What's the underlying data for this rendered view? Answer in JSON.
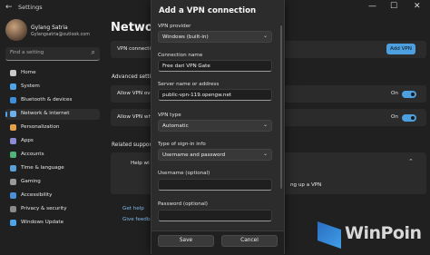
{
  "window": {
    "title": "Settings",
    "back_glyph": "←",
    "min_glyph": "—",
    "max_glyph": "☐",
    "close_glyph": "✕"
  },
  "user": {
    "name": "Gylang Satria",
    "email": "Gylangsatria@outlook.com"
  },
  "search": {
    "placeholder": "Find a setting",
    "icon": "⌕"
  },
  "sidebar": {
    "items": [
      {
        "label": "Home",
        "icon_color": "#c9c9c9"
      },
      {
        "label": "System",
        "icon_color": "#4fa4e8"
      },
      {
        "label": "Bluetooth & devices",
        "icon_color": "#3f8fd8"
      },
      {
        "label": "Network & internet",
        "icon_color": "#6db0ea"
      },
      {
        "label": "Personalization",
        "icon_color": "#e2a04a"
      },
      {
        "label": "Apps",
        "icon_color": "#8c8cd6"
      },
      {
        "label": "Accounts",
        "icon_color": "#4fb37a"
      },
      {
        "label": "Time & language",
        "icon_color": "#5aa0d8"
      },
      {
        "label": "Gaming",
        "icon_color": "#9a9a9a"
      },
      {
        "label": "Accessibility",
        "icon_color": "#4a90d9"
      },
      {
        "label": "Privacy & security",
        "icon_color": "#8a8a8a"
      },
      {
        "label": "Windows Update",
        "icon_color": "#4fa4e8"
      }
    ]
  },
  "main": {
    "title": "Network",
    "vpn_connections": "VPN connection",
    "add_vpn": "Add VPN",
    "advanced": "Advanced setting",
    "allow_over": "Allow VPN ove",
    "allow_while": "Allow VPN whi",
    "on1": "On",
    "on2": "On",
    "related": "Related support",
    "help": "Help wi",
    "setup": "ng up a VPN",
    "get_help": "Get help",
    "give_feedback": "Give feedback"
  },
  "modal": {
    "title": "Add a VPN connection",
    "vpn_provider_label": "VPN provider",
    "vpn_provider_value": "Windows (built-in)",
    "connection_name_label": "Connection name",
    "connection_name_value": "Free dari VPN Gate",
    "server_label": "Server name or address",
    "server_value": "public-vpn-119.opengw.net",
    "vpn_type_label": "VPN type",
    "vpn_type_value": "Automatic",
    "signin_label": "Type of sign-in info",
    "signin_value": "Username and password",
    "username_label": "Username (optional)",
    "password_label": "Password (optional)",
    "save": "Save",
    "cancel": "Cancel",
    "chevron": "⌄"
  },
  "brand": {
    "logo_text": "WinPoin"
  },
  "colors": {
    "accent": "#4ca0e0",
    "bg": "#202020",
    "modal": "#2c2c2c"
  }
}
